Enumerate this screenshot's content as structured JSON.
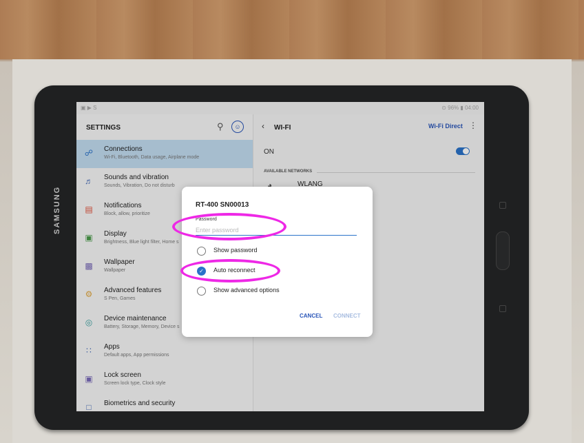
{
  "device": {
    "brand": "SAMSUNG"
  },
  "status_bar": {
    "left": "▣ ▶ S",
    "right": "⊙ 96% ▮ 04:00"
  },
  "settings": {
    "title": "SETTINGS",
    "items": [
      {
        "label": "Connections",
        "sub": "Wi-Fi, Bluetooth, Data usage, Airplane mode",
        "icon": "connections-icon"
      },
      {
        "label": "Sounds and vibration",
        "sub": "Sounds, Vibration, Do not disturb",
        "icon": "sound-icon"
      },
      {
        "label": "Notifications",
        "sub": "Block, allow, prioritize",
        "icon": "notifications-icon"
      },
      {
        "label": "Display",
        "sub": "Brightness, Blue light filter, Home s",
        "icon": "display-icon"
      },
      {
        "label": "Wallpaper",
        "sub": "Wallpaper",
        "icon": "wallpaper-icon"
      },
      {
        "label": "Advanced features",
        "sub": "S Pen, Games",
        "icon": "advanced-features-icon"
      },
      {
        "label": "Device maintenance",
        "sub": "Battery, Storage, Memory, Device s",
        "icon": "device-maintenance-icon"
      },
      {
        "label": "Apps",
        "sub": "Default apps, App permissions",
        "icon": "apps-icon"
      },
      {
        "label": "Lock screen",
        "sub": "Screen lock type, Clock style",
        "icon": "lock-screen-icon"
      },
      {
        "label": "Biometrics and security",
        "sub": "",
        "icon": "biometrics-icon"
      }
    ]
  },
  "wifi": {
    "title": "WI-FI",
    "direct": "Wi-Fi Direct",
    "state": "ON",
    "available_heading": "AVAILABLE NETWORKS",
    "network": "WLANG"
  },
  "dialog": {
    "title": "RT-400 SN00013",
    "password_label": "Password",
    "password_placeholder": "Enter password",
    "options": [
      {
        "label": "Show password",
        "checked": false
      },
      {
        "label": "Auto reconnect",
        "checked": true
      },
      {
        "label": "Show advanced options",
        "checked": false
      }
    ],
    "cancel": "CANCEL",
    "connect": "CONNECT"
  },
  "colors": {
    "accent": "#2a73c9",
    "highlight": "#ee28e6",
    "selected_row": "#c2dcf0"
  }
}
